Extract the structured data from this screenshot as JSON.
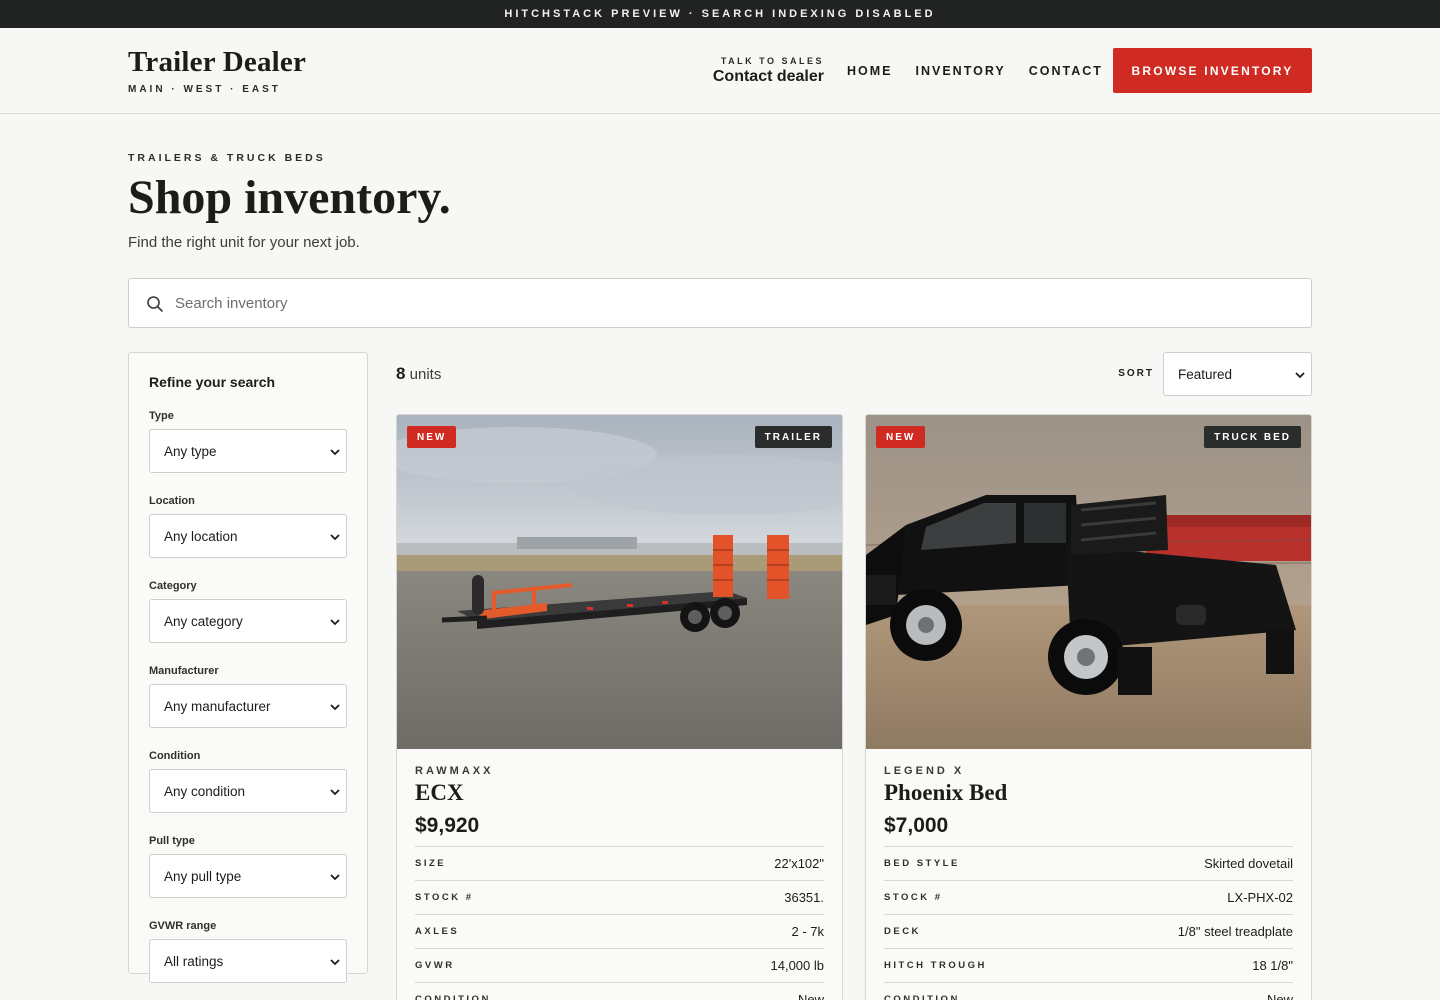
{
  "preview_bar": "HITCHSTACK PREVIEW · SEARCH INDEXING DISABLED",
  "header": {
    "brand_name": "Trailer Dealer",
    "brand_sub": "MAIN · WEST · EAST",
    "sales_kicker": "TALK TO SALES",
    "sales_main": "Contact dealer",
    "nav": [
      "HOME",
      "INVENTORY",
      "CONTACT"
    ],
    "cta": "BROWSE INVENTORY",
    "cta_color": "#cf2b22"
  },
  "hero": {
    "eyebrow": "TRAILERS & TRUCK BEDS",
    "title": "Shop inventory.",
    "subtitle": "Find the right unit for your next job."
  },
  "search": {
    "placeholder": "Search inventory",
    "value": ""
  },
  "filters": {
    "heading": "Refine your search",
    "groups": [
      {
        "label": "Type",
        "value": "Any type"
      },
      {
        "label": "Location",
        "value": "Any location"
      },
      {
        "label": "Category",
        "value": "Any category"
      },
      {
        "label": "Manufacturer",
        "value": "Any manufacturer"
      },
      {
        "label": "Condition",
        "value": "Any condition"
      },
      {
        "label": "Pull type",
        "value": "Any pull type"
      },
      {
        "label": "GVWR range",
        "value": "All ratings"
      }
    ]
  },
  "results": {
    "count": "8",
    "count_suffix": " units",
    "sort_label": "SORT",
    "sort_value": "Featured"
  },
  "cards": [
    {
      "badge": "NEW",
      "type": "TRAILER",
      "maker": "RAWMAXX",
      "model": "ECX",
      "price": "$9,920",
      "specs": [
        {
          "key": "SIZE",
          "val": "22'x102\""
        },
        {
          "key": "STOCK #",
          "val": "36351."
        },
        {
          "key": "AXLES",
          "val": "2 - 7k"
        },
        {
          "key": "GVWR",
          "val": "14,000 lb"
        },
        {
          "key": "CONDITION",
          "val": "New"
        }
      ]
    },
    {
      "badge": "NEW",
      "type": "TRUCK BED",
      "maker": "LEGEND X",
      "model": "Phoenix Bed",
      "price": "$7,000",
      "specs": [
        {
          "key": "BED STYLE",
          "val": "Skirted dovetail"
        },
        {
          "key": "STOCK #",
          "val": "LX-PHX-02"
        },
        {
          "key": "DECK",
          "val": "1/8\" steel treadplate"
        },
        {
          "key": "HITCH TROUGH",
          "val": "18 1/8\""
        },
        {
          "key": "CONDITION",
          "val": "New"
        }
      ]
    }
  ]
}
